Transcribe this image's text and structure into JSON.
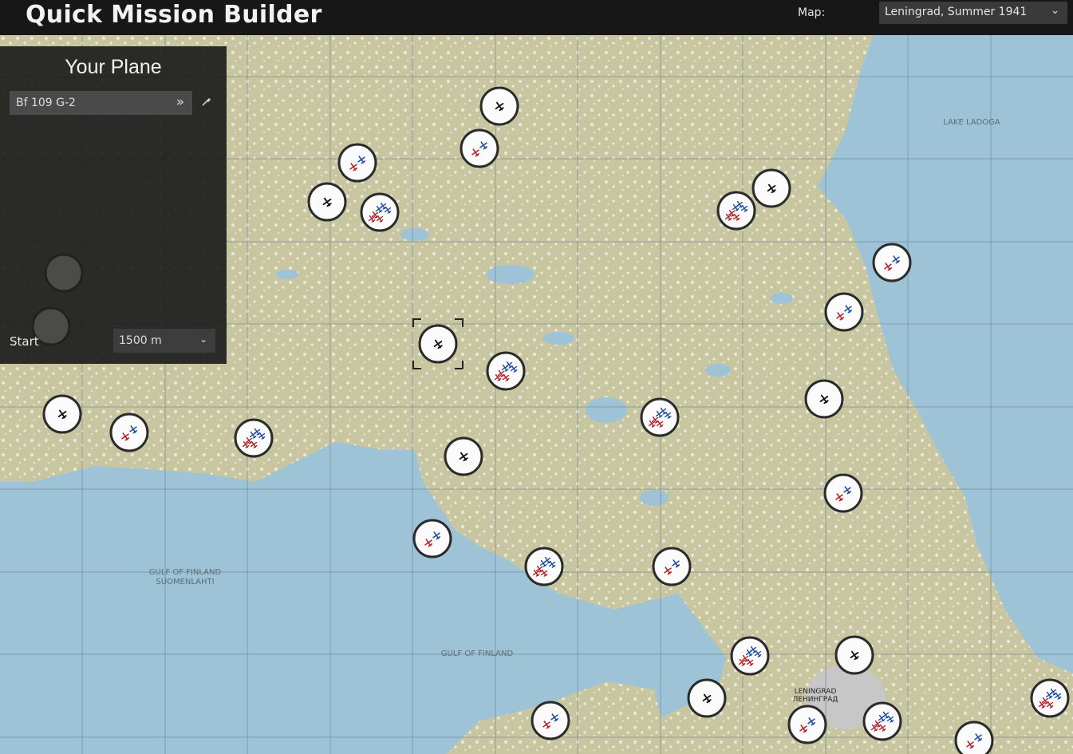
{
  "app": {
    "title": "Quick Mission Builder"
  },
  "map_picker": {
    "label": "Map:",
    "selected": "Leningrad, Summer 1941"
  },
  "panel": {
    "title": "Your Plane",
    "plane": "Bf 109 G-2",
    "start_label": "Start",
    "altitude": "1500 m"
  },
  "map": {
    "labels": {
      "gulf_of_finland_1": "GULF OF FINLAND",
      "gulf_of_finland_1b": "SUOMENLAHTI",
      "gulf_of_finland_2": "GULF OF FINLAND",
      "lake_ladoga": "LAKE LADOGA",
      "city": "LENINGRAD",
      "city_ru": "ЛЕНИНГРАД"
    }
  },
  "colors": {
    "water": "#9ec3d6",
    "land": "#c9c7a2",
    "blue_flight": "#1f4f9c",
    "red_flight": "#b0242a"
  },
  "icons": [
    "single-airfield-icon",
    "friendly-flight-icon",
    "enemy-flight-icon",
    "double-chevron-icon",
    "wrench-icon",
    "chevron-down-icon"
  ]
}
